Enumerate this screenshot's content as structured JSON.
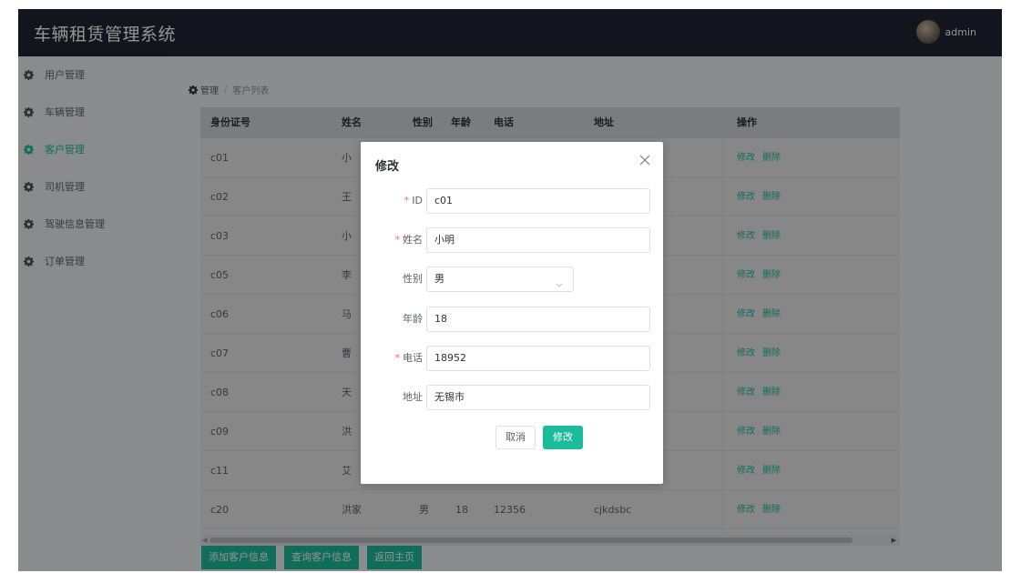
{
  "header": {
    "title": "车辆租赁管理系统",
    "user": "admin"
  },
  "sidebar": {
    "items": [
      {
        "label": "用户管理",
        "active": false
      },
      {
        "label": "车辆管理",
        "active": false
      },
      {
        "label": "客户管理",
        "active": true
      },
      {
        "label": "司机管理",
        "active": false
      },
      {
        "label": "驾驶信息管理",
        "active": false
      },
      {
        "label": "订单管理",
        "active": false
      }
    ]
  },
  "breadcrumb": {
    "root": "管理",
    "separator": "/",
    "current": "客户列表"
  },
  "table": {
    "columns": [
      "身份证号",
      "姓名",
      "性别",
      "年龄",
      "电话",
      "地址",
      "操作"
    ],
    "rows": [
      {
        "id": "c01",
        "name": "小",
        "gender": "",
        "age": "",
        "phone": "",
        "address": ""
      },
      {
        "id": "c02",
        "name": "王",
        "gender": "",
        "age": "",
        "phone": "",
        "address": ""
      },
      {
        "id": "c03",
        "name": "小",
        "gender": "",
        "age": "",
        "phone": "",
        "address": ""
      },
      {
        "id": "c05",
        "name": "李",
        "gender": "",
        "age": "",
        "phone": "",
        "address": ""
      },
      {
        "id": "c06",
        "name": "马",
        "gender": "",
        "age": "",
        "phone": "",
        "address": ""
      },
      {
        "id": "c07",
        "name": "曹",
        "gender": "",
        "age": "",
        "phone": "",
        "address": ""
      },
      {
        "id": "c08",
        "name": "天",
        "gender": "",
        "age": "",
        "phone": "",
        "address": ""
      },
      {
        "id": "c09",
        "name": "洪",
        "gender": "",
        "age": "",
        "phone": "",
        "address": ""
      },
      {
        "id": "c11",
        "name": "艾",
        "gender": "",
        "age": "",
        "phone": "",
        "address": ""
      },
      {
        "id": "c20",
        "name": "洪家",
        "gender": "男",
        "age": "18",
        "phone": "12356",
        "address": "cjkdsbc"
      }
    ],
    "action_edit": "修改",
    "action_delete": "删除"
  },
  "bottom_buttons": {
    "add": "添加客户信息",
    "query": "查询客户信息",
    "back": "返回主页"
  },
  "dialog": {
    "title": "修改",
    "fields": {
      "id": {
        "label": "ID",
        "value": "c01",
        "required": true
      },
      "name": {
        "label": "姓名",
        "value": "小明",
        "required": true
      },
      "gender": {
        "label": "性别",
        "value": "男",
        "required": false
      },
      "age": {
        "label": "年龄",
        "value": "18",
        "required": false
      },
      "phone": {
        "label": "电话",
        "value": "18952",
        "required": true
      },
      "address": {
        "label": "地址",
        "value": "无锡市",
        "required": false
      }
    },
    "cancel": "取消",
    "submit": "修改"
  },
  "colors": {
    "accent": "#1abc9c",
    "header_bg": "#1f2533",
    "sidebar_bg": "#eef0f3",
    "required": "#f56c6c"
  }
}
